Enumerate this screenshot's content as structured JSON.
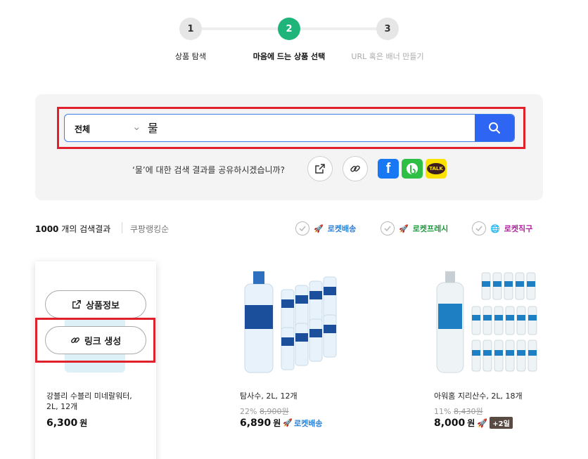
{
  "steps": [
    {
      "num": "1",
      "label": "상품 탐색"
    },
    {
      "num": "2",
      "label": "마음에 드는 상품 선택"
    },
    {
      "num": "3",
      "label": "URL 혹은 배너 만들기"
    }
  ],
  "search": {
    "category": "전체",
    "query": "물"
  },
  "share": {
    "text": "‘물’에 대한 검색 결과를 공유하시겠습니까?",
    "kakao_label": "TALK"
  },
  "results": {
    "count": "1000",
    "count_suffix": " 개의 검색결과",
    "sort": "쿠팡랭킹순"
  },
  "filters": [
    {
      "label": "로켓배송",
      "color": "#2d7fd6"
    },
    {
      "label": "로켓프레시",
      "color": "#1a9c3a"
    },
    {
      "label": "로켓직구",
      "color": "#b21f9e"
    }
  ],
  "overlay": {
    "product_info": "상품정보",
    "make_link": "링크 생성"
  },
  "products": [
    {
      "name": "강블리 수블리 미네랄워터, 2L, 12개",
      "price": "6,300",
      "won": "원"
    },
    {
      "name": "탐사수, 2L, 12개",
      "discount": "22%",
      "original": "8,900원",
      "price": "6,890",
      "won": "원",
      "tag": "로켓배송"
    },
    {
      "name": "아워홈 지리산수, 2L, 18개",
      "discount": "11%",
      "original": "8,430원",
      "price": "8,000",
      "won": "원",
      "badge": "+2일"
    }
  ],
  "colors": {
    "accent_green": "#1fb47a",
    "search_blue": "#2e65f3",
    "highlight_red": "#e0202a"
  }
}
